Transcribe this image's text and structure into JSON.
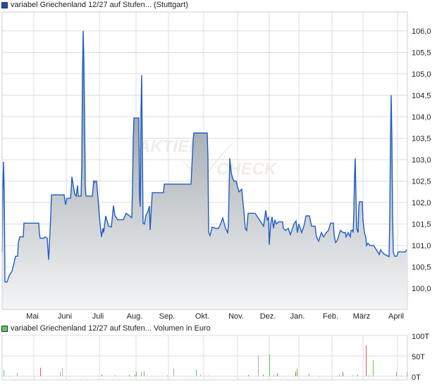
{
  "legend_price": {
    "label": "variabel Griechenland 12/27 auf Stufen... (Stuttgart)",
    "color": "#1f4fb0"
  },
  "legend_volume": {
    "label": "variabel Griechenland 12/27 auf Stufen... Volumen in Euro",
    "color": "#5ccc5c"
  },
  "watermark": {
    "line1": "AKTIEN",
    "line2": "CHECK"
  },
  "colors": {
    "line": "#1f5bc4",
    "fill_top": "#7f8a92",
    "fill_bottom": "#f4f5f6",
    "grid": "#dcdcdc",
    "vol_up": "#4fd04f",
    "vol_down": "#e05555",
    "vol_flat": "#b0b0b0"
  },
  "chart_data": [
    {
      "type": "area",
      "title": "variabel Griechenland 12/27 auf Stufen... (Stuttgart)",
      "x_unit": "time index",
      "xlim": [
        0,
        575
      ],
      "ylim": [
        99.51,
        106.44
      ],
      "grid": true,
      "yticks": [
        {
          "v": 106.0,
          "label": "106,0"
        },
        {
          "v": 105.5,
          "label": "105,5"
        },
        {
          "v": 105.0,
          "label": "105,0"
        },
        {
          "v": 104.5,
          "label": "104,5"
        },
        {
          "v": 104.0,
          "label": "104,0"
        },
        {
          "v": 103.5,
          "label": "103,5"
        },
        {
          "v": 103.0,
          "label": "103,0"
        },
        {
          "v": 102.5,
          "label": "102,5"
        },
        {
          "v": 102.0,
          "label": "102,0"
        },
        {
          "v": 101.5,
          "label": "101,5"
        },
        {
          "v": 101.0,
          "label": "101,0"
        },
        {
          "v": 100.5,
          "label": "100,5"
        },
        {
          "v": 100.0,
          "label": "100,0"
        }
      ],
      "xticks": [
        {
          "x": 45,
          "label": "Mai"
        },
        {
          "x": 91,
          "label": "Juni"
        },
        {
          "x": 138,
          "label": "Juli"
        },
        {
          "x": 190,
          "label": "Aug."
        },
        {
          "x": 236,
          "label": "Sep."
        },
        {
          "x": 286,
          "label": "Okt."
        },
        {
          "x": 334,
          "label": "Nov."
        },
        {
          "x": 379,
          "label": "Dez."
        },
        {
          "x": 421,
          "label": "Jan."
        },
        {
          "x": 468,
          "label": "Feb."
        },
        {
          "x": 512,
          "label": "März"
        },
        {
          "x": 561,
          "label": "April"
        }
      ],
      "points": [
        [
          0,
          100.85
        ],
        [
          1,
          102.26
        ],
        [
          2,
          102.95
        ],
        [
          3,
          102.26
        ],
        [
          4,
          100.15
        ],
        [
          7,
          100.15
        ],
        [
          10,
          100.3
        ],
        [
          14,
          100.4
        ],
        [
          17,
          100.6
        ],
        [
          19,
          100.75
        ],
        [
          22,
          100.75
        ],
        [
          23,
          101.05
        ],
        [
          25,
          101.2
        ],
        [
          30,
          101.2
        ],
        [
          31,
          101.52
        ],
        [
          52,
          101.52
        ],
        [
          53,
          101.26
        ],
        [
          54,
          101.17
        ],
        [
          59,
          101.17
        ],
        [
          61,
          101.2
        ],
        [
          64,
          101.17
        ],
        [
          65,
          100.9
        ],
        [
          66,
          100.67
        ],
        [
          67,
          101.0
        ],
        [
          69,
          101.7
        ],
        [
          70,
          102.18
        ],
        [
          88,
          102.18
        ],
        [
          90,
          101.95
        ],
        [
          92,
          102.1
        ],
        [
          97,
          102.1
        ],
        [
          98,
          102.3
        ],
        [
          99,
          102.6
        ],
        [
          101,
          102.4
        ],
        [
          103,
          102.2
        ],
        [
          105,
          102.15
        ],
        [
          107,
          102.4
        ],
        [
          108,
          102.15
        ],
        [
          112,
          102.15
        ],
        [
          113,
          102.8
        ],
        [
          114,
          105.0
        ],
        [
          115,
          106.0
        ],
        [
          116,
          105.33
        ],
        [
          117,
          104.05
        ],
        [
          118,
          102.4
        ],
        [
          119,
          102.15
        ],
        [
          128,
          102.15
        ],
        [
          130,
          102.5
        ],
        [
          131,
          102.47
        ],
        [
          132,
          102.5
        ],
        [
          134,
          102.5
        ],
        [
          136,
          102.1
        ],
        [
          139,
          101.5
        ],
        [
          141,
          101.2
        ],
        [
          143,
          101.4
        ],
        [
          144,
          101.3
        ],
        [
          147,
          101.69
        ],
        [
          151,
          101.45
        ],
        [
          155,
          101.43
        ],
        [
          158,
          101.93
        ],
        [
          160,
          101.7
        ],
        [
          164,
          101.6
        ],
        [
          172,
          101.6
        ],
        [
          176,
          101.75
        ],
        [
          180,
          101.7
        ],
        [
          184,
          101.65
        ],
        [
          185,
          102.4
        ],
        [
          186,
          103.44
        ],
        [
          187,
          103.97
        ],
        [
          194,
          103.97
        ],
        [
          195,
          102.1
        ],
        [
          196,
          101.9
        ],
        [
          197,
          104.1
        ],
        [
          198,
          104.97
        ],
        [
          199,
          103.2
        ],
        [
          200,
          101.52
        ],
        [
          202,
          101.5
        ],
        [
          204,
          101.7
        ],
        [
          207,
          101.8
        ],
        [
          209,
          101.92
        ],
        [
          210,
          101.36
        ],
        [
          213,
          102.23
        ],
        [
          229,
          102.23
        ],
        [
          230,
          102.43
        ],
        [
          268,
          102.43
        ],
        [
          271,
          103.44
        ],
        [
          272,
          103.62
        ],
        [
          291,
          103.62
        ],
        [
          292,
          103.07
        ],
        [
          293,
          101.31
        ],
        [
          295,
          101.23
        ],
        [
          298,
          101.43
        ],
        [
          303,
          101.4
        ],
        [
          307,
          101.4
        ],
        [
          310,
          101.5
        ],
        [
          313,
          101.64
        ],
        [
          317,
          101.4
        ],
        [
          320,
          101.3
        ],
        [
          321,
          101.45
        ],
        [
          322,
          102.3
        ],
        [
          323,
          103.03
        ],
        [
          325,
          102.7
        ],
        [
          327,
          102.57
        ],
        [
          329,
          102.5
        ],
        [
          332,
          102.5
        ],
        [
          336,
          102.25
        ],
        [
          340,
          102.31
        ],
        [
          343,
          101.8
        ],
        [
          345,
          101.39
        ],
        [
          347,
          101.35
        ],
        [
          349,
          101.75
        ],
        [
          359,
          101.75
        ],
        [
          363,
          101.65
        ],
        [
          367,
          101.55
        ],
        [
          371,
          101.45
        ],
        [
          374,
          101.82
        ],
        [
          376,
          101.6
        ],
        [
          378,
          101.65
        ],
        [
          379,
          101.02
        ],
        [
          381,
          101.5
        ],
        [
          383,
          101.67
        ],
        [
          385,
          101.4
        ],
        [
          387,
          101.6
        ],
        [
          389,
          101.5
        ],
        [
          392,
          101.55
        ],
        [
          398,
          101.55
        ],
        [
          399,
          101.4
        ],
        [
          402,
          101.35
        ],
        [
          406,
          101.4
        ],
        [
          409,
          101.25
        ],
        [
          411,
          101.35
        ],
        [
          414,
          101.5
        ],
        [
          417,
          101.57
        ],
        [
          419,
          101.3
        ],
        [
          421,
          101.5
        ],
        [
          424,
          101.35
        ],
        [
          425,
          101.3
        ],
        [
          429,
          101.5
        ],
        [
          431,
          101.69
        ],
        [
          436,
          101.69
        ],
        [
          439,
          101.45
        ],
        [
          444,
          101.45
        ],
        [
          446,
          101.2
        ],
        [
          449,
          101.1
        ],
        [
          453,
          101.3
        ],
        [
          456,
          101.2
        ],
        [
          460,
          101.3
        ],
        [
          463,
          101.35
        ],
        [
          466,
          101.52
        ],
        [
          470,
          101.52
        ],
        [
          471,
          101.25
        ],
        [
          473,
          101.07
        ],
        [
          475,
          101.1
        ],
        [
          477,
          101.2
        ],
        [
          480,
          101.35
        ],
        [
          484,
          101.3
        ],
        [
          487,
          101.3
        ],
        [
          488,
          101.2
        ],
        [
          491,
          101.3
        ],
        [
          494,
          101.2
        ],
        [
          495,
          101.35
        ],
        [
          497,
          101.36
        ],
        [
          498,
          101.3
        ],
        [
          499,
          101.75
        ],
        [
          500,
          102.62
        ],
        [
          501,
          103.03
        ],
        [
          502,
          102.2
        ],
        [
          503,
          101.4
        ],
        [
          505,
          101.3
        ],
        [
          506,
          101.9
        ],
        [
          507,
          102.02
        ],
        [
          511,
          102.02
        ],
        [
          512,
          101.6
        ],
        [
          514,
          101.3
        ],
        [
          516,
          101.2
        ],
        [
          517,
          101.0
        ],
        [
          519,
          101.05
        ],
        [
          522,
          101.0
        ],
        [
          527,
          101.0
        ],
        [
          531,
          100.9
        ],
        [
          535,
          100.79
        ],
        [
          537,
          100.9
        ],
        [
          539,
          100.85
        ],
        [
          542,
          100.8
        ],
        [
          549,
          100.74
        ],
        [
          550,
          101.7
        ],
        [
          551,
          103.52
        ],
        [
          552,
          104.5
        ],
        [
          553,
          103.5
        ],
        [
          554,
          101.7
        ],
        [
          555,
          100.85
        ],
        [
          557,
          100.75
        ],
        [
          560,
          100.75
        ],
        [
          562,
          100.85
        ],
        [
          572,
          100.85
        ],
        [
          574,
          100.9
        ]
      ]
    },
    {
      "type": "bar",
      "title": "variabel Griechenland 12/27 auf Stufen... Volumen in Euro",
      "x_unit": "time index",
      "ylim": [
        0,
        100
      ],
      "y_unit": "T",
      "yticks": [
        {
          "v": 100,
          "label": "100T"
        },
        {
          "v": 50,
          "label": "50T"
        },
        {
          "v": 0,
          "label": "0T"
        }
      ],
      "bars": [
        {
          "x": 2,
          "v": 15,
          "dir": "up"
        },
        {
          "x": 10,
          "v": 1,
          "dir": "up"
        },
        {
          "x": 21,
          "v": 9,
          "dir": "flat"
        },
        {
          "x": 40,
          "v": 1,
          "dir": "flat"
        },
        {
          "x": 54,
          "v": 21,
          "dir": "down"
        },
        {
          "x": 82,
          "v": 11,
          "dir": "flat"
        },
        {
          "x": 85,
          "v": 21,
          "dir": "flat"
        },
        {
          "x": 95,
          "v": 1,
          "dir": "up"
        },
        {
          "x": 117,
          "v": 1,
          "dir": "up"
        },
        {
          "x": 141,
          "v": 4,
          "dir": "down"
        },
        {
          "x": 160,
          "v": 2,
          "dir": "down"
        },
        {
          "x": 180,
          "v": 3,
          "dir": "down"
        },
        {
          "x": 188,
          "v": 4,
          "dir": "up"
        },
        {
          "x": 190,
          "v": 11,
          "dir": "up"
        },
        {
          "x": 197,
          "v": 11,
          "dir": "flat"
        },
        {
          "x": 201,
          "v": 12,
          "dir": "up"
        },
        {
          "x": 212,
          "v": 1,
          "dir": "up"
        },
        {
          "x": 234,
          "v": 2,
          "dir": "up"
        },
        {
          "x": 243,
          "v": 19,
          "dir": "flat"
        },
        {
          "x": 260,
          "v": 1,
          "dir": "flat"
        },
        {
          "x": 275,
          "v": 16,
          "dir": "up"
        },
        {
          "x": 281,
          "v": 4,
          "dir": "flat"
        },
        {
          "x": 292,
          "v": 2,
          "dir": "flat"
        },
        {
          "x": 330,
          "v": 1,
          "dir": "down"
        },
        {
          "x": 349,
          "v": 3,
          "dir": "down"
        },
        {
          "x": 363,
          "v": 50,
          "dir": "flat"
        },
        {
          "x": 370,
          "v": 4,
          "dir": "down"
        },
        {
          "x": 379,
          "v": 54,
          "dir": "up"
        },
        {
          "x": 385,
          "v": 2,
          "dir": "down"
        },
        {
          "x": 390,
          "v": 7,
          "dir": "down"
        },
        {
          "x": 400,
          "v": 1,
          "dir": "up"
        },
        {
          "x": 416,
          "v": 11,
          "dir": "down"
        },
        {
          "x": 418,
          "v": 19,
          "dir": "up"
        },
        {
          "x": 435,
          "v": 6,
          "dir": "up"
        },
        {
          "x": 450,
          "v": 1,
          "dir": "up"
        },
        {
          "x": 478,
          "v": 3,
          "dir": "down"
        },
        {
          "x": 483,
          "v": 11,
          "dir": "down"
        },
        {
          "x": 497,
          "v": 2,
          "dir": "up"
        },
        {
          "x": 504,
          "v": 4,
          "dir": "up"
        },
        {
          "x": 516,
          "v": 76,
          "dir": "down"
        },
        {
          "x": 520,
          "v": 2,
          "dir": "down"
        },
        {
          "x": 526,
          "v": 39,
          "dir": "up"
        },
        {
          "x": 559,
          "v": 11,
          "dir": "up"
        },
        {
          "x": 566,
          "v": 2,
          "dir": "down"
        },
        {
          "x": 574,
          "v": 11,
          "dir": "flat"
        }
      ]
    }
  ]
}
